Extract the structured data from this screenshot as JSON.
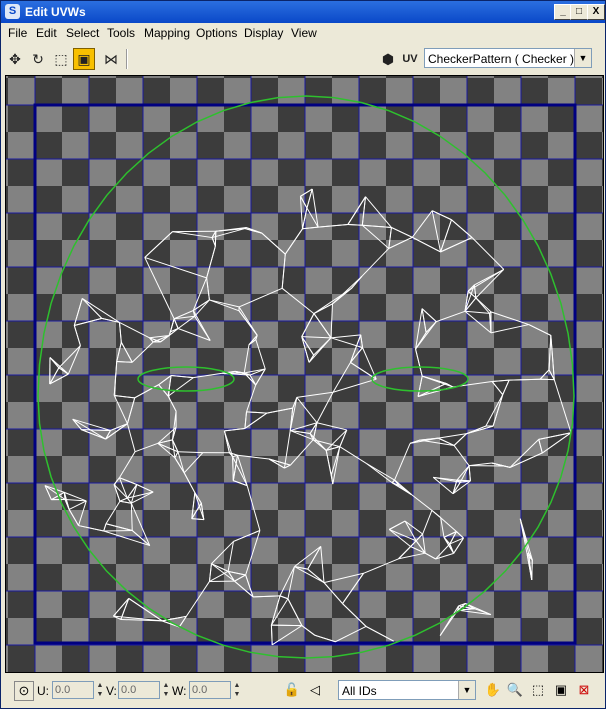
{
  "window": {
    "title": "Edit UVWs"
  },
  "title_buttons": {
    "minimize": "_",
    "maximize": "□",
    "close": "X"
  },
  "menu": [
    "File",
    "Edit",
    "Select",
    "Tools",
    "Mapping",
    "Options",
    "Display",
    "View"
  ],
  "toolbar": {
    "tools": [
      "move-icon",
      "rotate-icon",
      "scale-icon",
      "freeform-icon",
      "mirror-icon"
    ],
    "uv_label": "UV",
    "texture_dropdown": "CheckerPattern  ( Checker )"
  },
  "status": {
    "u_label": "U:",
    "u_value": "0.0",
    "v_label": "V:",
    "v_value": "0.0",
    "w_label": "W:",
    "w_value": "0.0",
    "id_filter": "All IDs"
  },
  "colors": {
    "checker_dark": "#3c3c3c",
    "checker_light": "#828282",
    "grid_line": "#1a1aa0",
    "mesh": "#ffffff",
    "seam": "#2ec02e",
    "tool_active": "#f8c000"
  }
}
